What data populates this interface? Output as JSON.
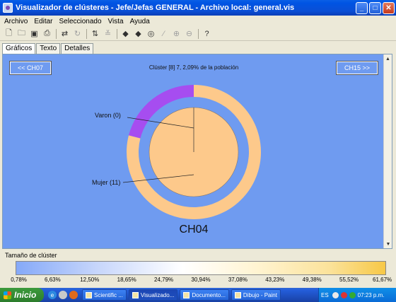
{
  "window": {
    "title": "Visualizador de clústeres - Jefe/Jefas GENERAL - Archivo local: general.vis",
    "buttons": {
      "minimize": "_",
      "maximize": "□",
      "close": "✕"
    }
  },
  "menu": [
    "Archivo",
    "Editar",
    "Seleccionado",
    "Vista",
    "Ayuda"
  ],
  "toolbar": {
    "icons": [
      "new-icon",
      "open-icon",
      "save-icon",
      "print-icon",
      "swap-icon",
      "refresh-icon",
      "sort-icon",
      "filter-icon",
      "back-icon",
      "forward-icon",
      "binoculars-icon",
      "magic-icon",
      "zoom-in-icon",
      "zoom-out-icon",
      "help-icon"
    ]
  },
  "tabs": [
    {
      "label": "Gráficos",
      "active": true
    },
    {
      "label": "Texto",
      "active": false
    },
    {
      "label": "Detalles",
      "active": false
    }
  ],
  "panel": {
    "prev_button": "<< CH07",
    "next_button": "CH15 >>",
    "caption": "Clúster [8] 7, 2,09% de la población"
  },
  "chart_data": {
    "type": "pie",
    "title": "CH04",
    "background": "#6f9bf0",
    "outer_ring": {
      "slices": [
        {
          "label": "Varon",
          "value": 0,
          "fraction": 0.21,
          "color": "#a64df0"
        },
        {
          "label": "Mujer",
          "value": 11,
          "fraction": 0.79,
          "color": "#fdc98b"
        }
      ]
    },
    "inner_pie": {
      "slices": [
        {
          "label": "Varon",
          "value": 0,
          "color": "#fdc98b"
        },
        {
          "label": "Mujer",
          "value": 11,
          "color": "#fdc98b"
        }
      ]
    },
    "labels": [
      "Varon (0)",
      "Mujer (11)"
    ]
  },
  "legend": {
    "title": "Tamaño de clúster",
    "ticks": [
      "0,78%",
      "6,63%",
      "12,50%",
      "18,65%",
      "24,79%",
      "30,94%",
      "37,08%",
      "43,23%",
      "49,38%",
      "55,52%",
      "61,67%"
    ]
  },
  "taskbar": {
    "start": "Inicio",
    "tasks": [
      {
        "label": "Scientific ...",
        "active": false
      },
      {
        "label": "Visualizado...",
        "active": true
      },
      {
        "label": "Documento...",
        "active": false
      },
      {
        "label": "Dibujo - Paint",
        "active": false
      }
    ],
    "language": "ES",
    "clock": "07:23 p.m."
  }
}
